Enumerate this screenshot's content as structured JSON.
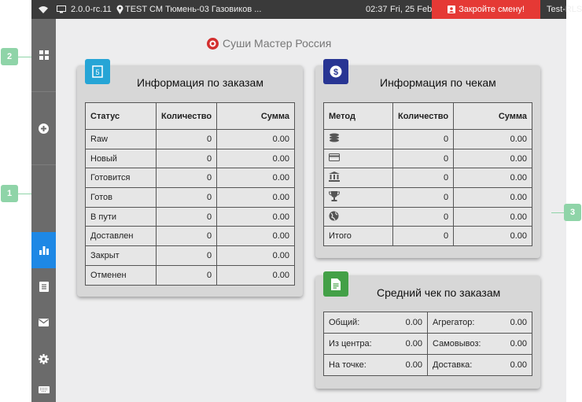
{
  "topbar": {
    "version": "2.0.0-rc.11",
    "location": "TEST CM Тюмень-03 Газовиков ...",
    "time": "02:37",
    "date": "Fri, 25 Feb",
    "close_shift": "Закройте смену!",
    "account": "Test-RLS"
  },
  "brand": {
    "name": "Суши Мастер Россия"
  },
  "orders": {
    "title": "Информация по заказам",
    "headers": [
      "Статус",
      "Количество",
      "Сумма"
    ],
    "rows": [
      [
        "Raw",
        "0",
        "0.00"
      ],
      [
        "Новый",
        "0",
        "0.00"
      ],
      [
        "Готовится",
        "0",
        "0.00"
      ],
      [
        "Готов",
        "0",
        "0.00"
      ],
      [
        "В пути",
        "0",
        "0.00"
      ],
      [
        "Доставлен",
        "0",
        "0.00"
      ],
      [
        "Закрыт",
        "0",
        "0.00"
      ],
      [
        "Отменен",
        "0",
        "0.00"
      ]
    ]
  },
  "checks": {
    "title": "Информация по чекам",
    "headers": [
      "Метод",
      "Количество",
      "Сумма"
    ],
    "rows": [
      {
        "icon": "coins-icon",
        "label": "",
        "qty": "0",
        "sum": "0.00"
      },
      {
        "icon": "card-icon",
        "label": "",
        "qty": "0",
        "sum": "0.00"
      },
      {
        "icon": "bank-icon",
        "label": "",
        "qty": "0",
        "sum": "0.00"
      },
      {
        "icon": "trophy-icon",
        "label": "",
        "qty": "0",
        "sum": "0.00"
      },
      {
        "icon": "globe-icon",
        "label": "",
        "qty": "0",
        "sum": "0.00"
      },
      {
        "icon": "",
        "label": "Итого",
        "qty": "0",
        "sum": "0.00"
      }
    ]
  },
  "avg": {
    "title": "Средний чек по заказам",
    "rows": [
      [
        "Общий:",
        "0.00",
        "Агрегатор:",
        "0.00"
      ],
      [
        "Из центра:",
        "0.00",
        "Самовывоз:",
        "0.00"
      ],
      [
        "На точке:",
        "0.00",
        "Доставка:",
        "0.00"
      ]
    ]
  },
  "callouts": [
    "1",
    "2",
    "3"
  ],
  "colors": {
    "accent": "#1e88e5",
    "close": "#e53935",
    "callout": "#8fd4a8",
    "orders_icon": "#26a5d6",
    "checks_icon": "#283593",
    "avg_icon": "#43a047"
  }
}
